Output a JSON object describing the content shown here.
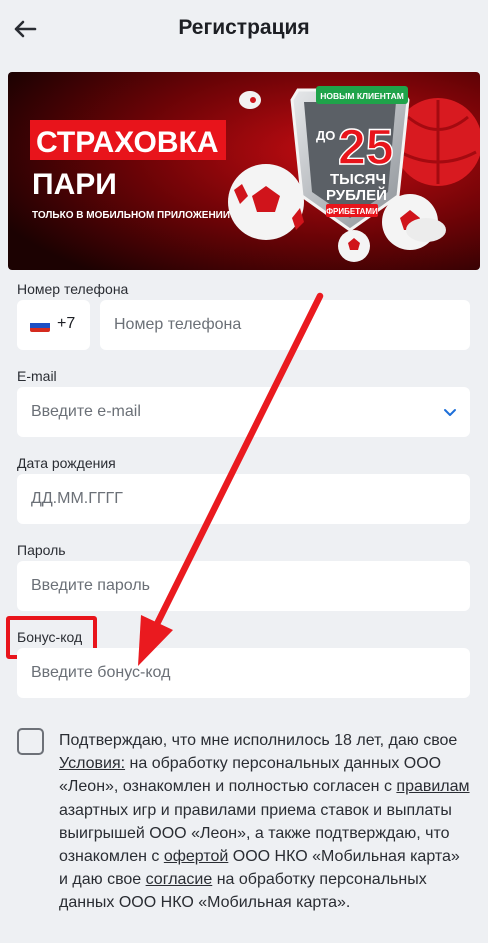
{
  "header": {
    "title": "Регистрация"
  },
  "banner": {
    "headline_1": "СТРАХОВКА",
    "headline_2": "ПАРИ",
    "sub": "ТОЛЬКО В МОБИЛЬНОМ ПРИЛОЖЕНИИ",
    "ribbon": "НОВЫМ КЛИЕНТАМ",
    "prefix": "ДО",
    "amount": "25",
    "unit_1": "ТЫСЯЧ",
    "unit_2": "РУБЛЕЙ",
    "tag": "ФРИБЕТАМИ"
  },
  "form": {
    "phone": {
      "label": "Номер телефона",
      "code": "+7",
      "placeholder": "Номер телефона"
    },
    "email": {
      "label": "E-mail",
      "placeholder": "Введите e-mail"
    },
    "birthdate": {
      "label": "Дата рождения",
      "placeholder": "ДД.ММ.ГГГГ"
    },
    "password": {
      "label": "Пароль",
      "placeholder": "Введите пароль"
    },
    "bonus": {
      "label": "Бонус-код",
      "placeholder": "Введите бонус-код"
    }
  },
  "consent": {
    "t1": "Подтверждаю, что мне исполнилось 18 лет, даю свое ",
    "link_terms": "Условия:",
    "t2": " на обработку персональных данных ООО «Леон», ознакомлен и полностью согласен с ",
    "link_rules": "правилам",
    "t3": " азартных игр и правилами приема ставок и выплаты выигрышей ООО «Леон», а также подтверждаю, что ознакомлен с ",
    "link_offer": "офертой",
    "t4": " ООО НКО «Мобильная карта» и даю свое ",
    "link_consent": "согласие",
    "t5": " на обработку персональных данных ООО НКО «Мобильная карта»."
  },
  "colors": {
    "accent_red": "#e8141b",
    "link_blue": "#1e6fd9",
    "background": "#eef0f3"
  },
  "icons": [
    "back-arrow-icon",
    "chevron-down-icon",
    "russia-flag-icon",
    "checkbox-icon"
  ]
}
